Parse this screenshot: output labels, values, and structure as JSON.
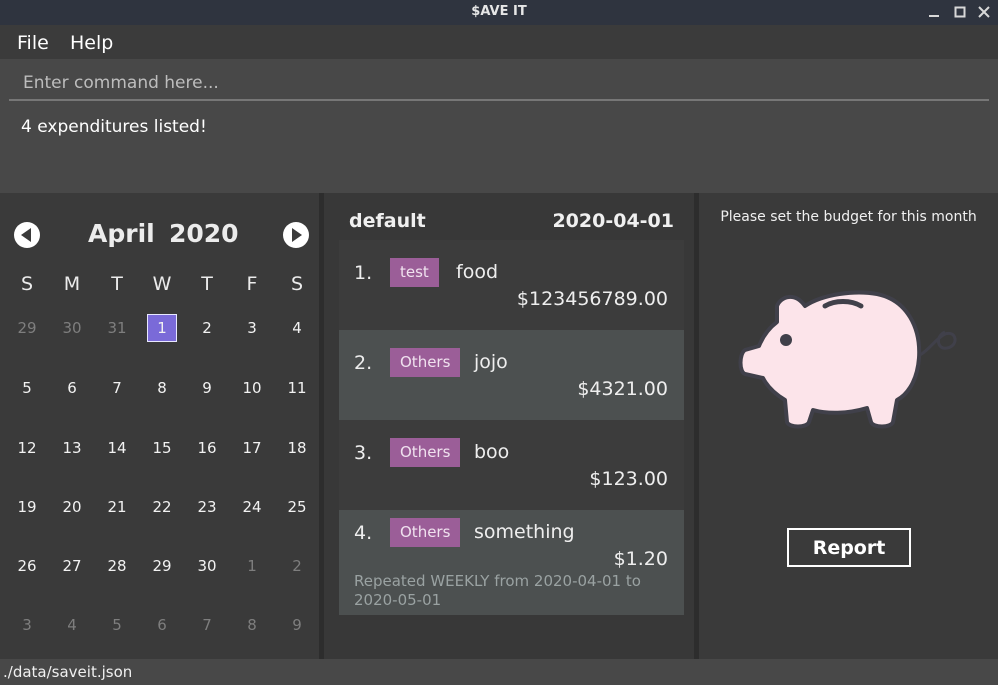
{
  "window": {
    "title": "$AVE IT",
    "controls": [
      "minimize-icon",
      "maximize-icon",
      "close-icon"
    ]
  },
  "menu": {
    "file": "File",
    "help": "Help"
  },
  "command": {
    "placeholder": "Enter command here...",
    "value": ""
  },
  "result": "4 expenditures listed!",
  "calendar": {
    "month": "April",
    "year": "2020",
    "weekdays": [
      "S",
      "M",
      "T",
      "W",
      "T",
      "F",
      "S"
    ],
    "weeks": [
      [
        {
          "d": "29",
          "dim": true
        },
        {
          "d": "30",
          "dim": true
        },
        {
          "d": "31",
          "dim": true
        },
        {
          "d": "1",
          "selected": true
        },
        {
          "d": "2"
        },
        {
          "d": "3"
        },
        {
          "d": "4"
        }
      ],
      [
        {
          "d": "5"
        },
        {
          "d": "6"
        },
        {
          "d": "7"
        },
        {
          "d": "8"
        },
        {
          "d": "9"
        },
        {
          "d": "10"
        },
        {
          "d": "11"
        }
      ],
      [
        {
          "d": "12"
        },
        {
          "d": "13"
        },
        {
          "d": "14"
        },
        {
          "d": "15"
        },
        {
          "d": "16"
        },
        {
          "d": "17"
        },
        {
          "d": "18"
        }
      ],
      [
        {
          "d": "19"
        },
        {
          "d": "20"
        },
        {
          "d": "21"
        },
        {
          "d": "22"
        },
        {
          "d": "23"
        },
        {
          "d": "24"
        },
        {
          "d": "25"
        }
      ],
      [
        {
          "d": "26"
        },
        {
          "d": "27"
        },
        {
          "d": "28"
        },
        {
          "d": "29"
        },
        {
          "d": "30"
        },
        {
          "d": "1",
          "dim": true
        },
        {
          "d": "2",
          "dim": true
        }
      ],
      [
        {
          "d": "3",
          "dim": true
        },
        {
          "d": "4",
          "dim": true
        },
        {
          "d": "5",
          "dim": true
        },
        {
          "d": "6",
          "dim": true
        },
        {
          "d": "7",
          "dim": true
        },
        {
          "d": "8",
          "dim": true
        },
        {
          "d": "9",
          "dim": true
        }
      ]
    ]
  },
  "list": {
    "account": "default",
    "date": "2020-04-01",
    "items": [
      {
        "index": "1.",
        "tag": "test",
        "name": "food",
        "amount": "$123456789.00",
        "repeat": ""
      },
      {
        "index": "2.",
        "tag": "Others",
        "name": "jojo",
        "amount": "$4321.00",
        "repeat": ""
      },
      {
        "index": "3.",
        "tag": "Others",
        "name": "boo",
        "amount": "$123.00",
        "repeat": ""
      },
      {
        "index": "4.",
        "tag": "Others",
        "name": "something",
        "amount": "$1.20",
        "repeat": "Repeated WEEKLY from 2020-04-01 to 2020-05-01"
      }
    ]
  },
  "budget": {
    "message": "Please set the budget for this month",
    "report_label": "Report",
    "icon": "piggy-bank-icon"
  },
  "status": {
    "path": "./data/saveit.json"
  },
  "colors": {
    "accent": "#7a6ad8",
    "tag": "#9b5e98",
    "card_light": "#4c5050",
    "card_dark": "#3c3c3c",
    "pig": "#fce4ea"
  }
}
